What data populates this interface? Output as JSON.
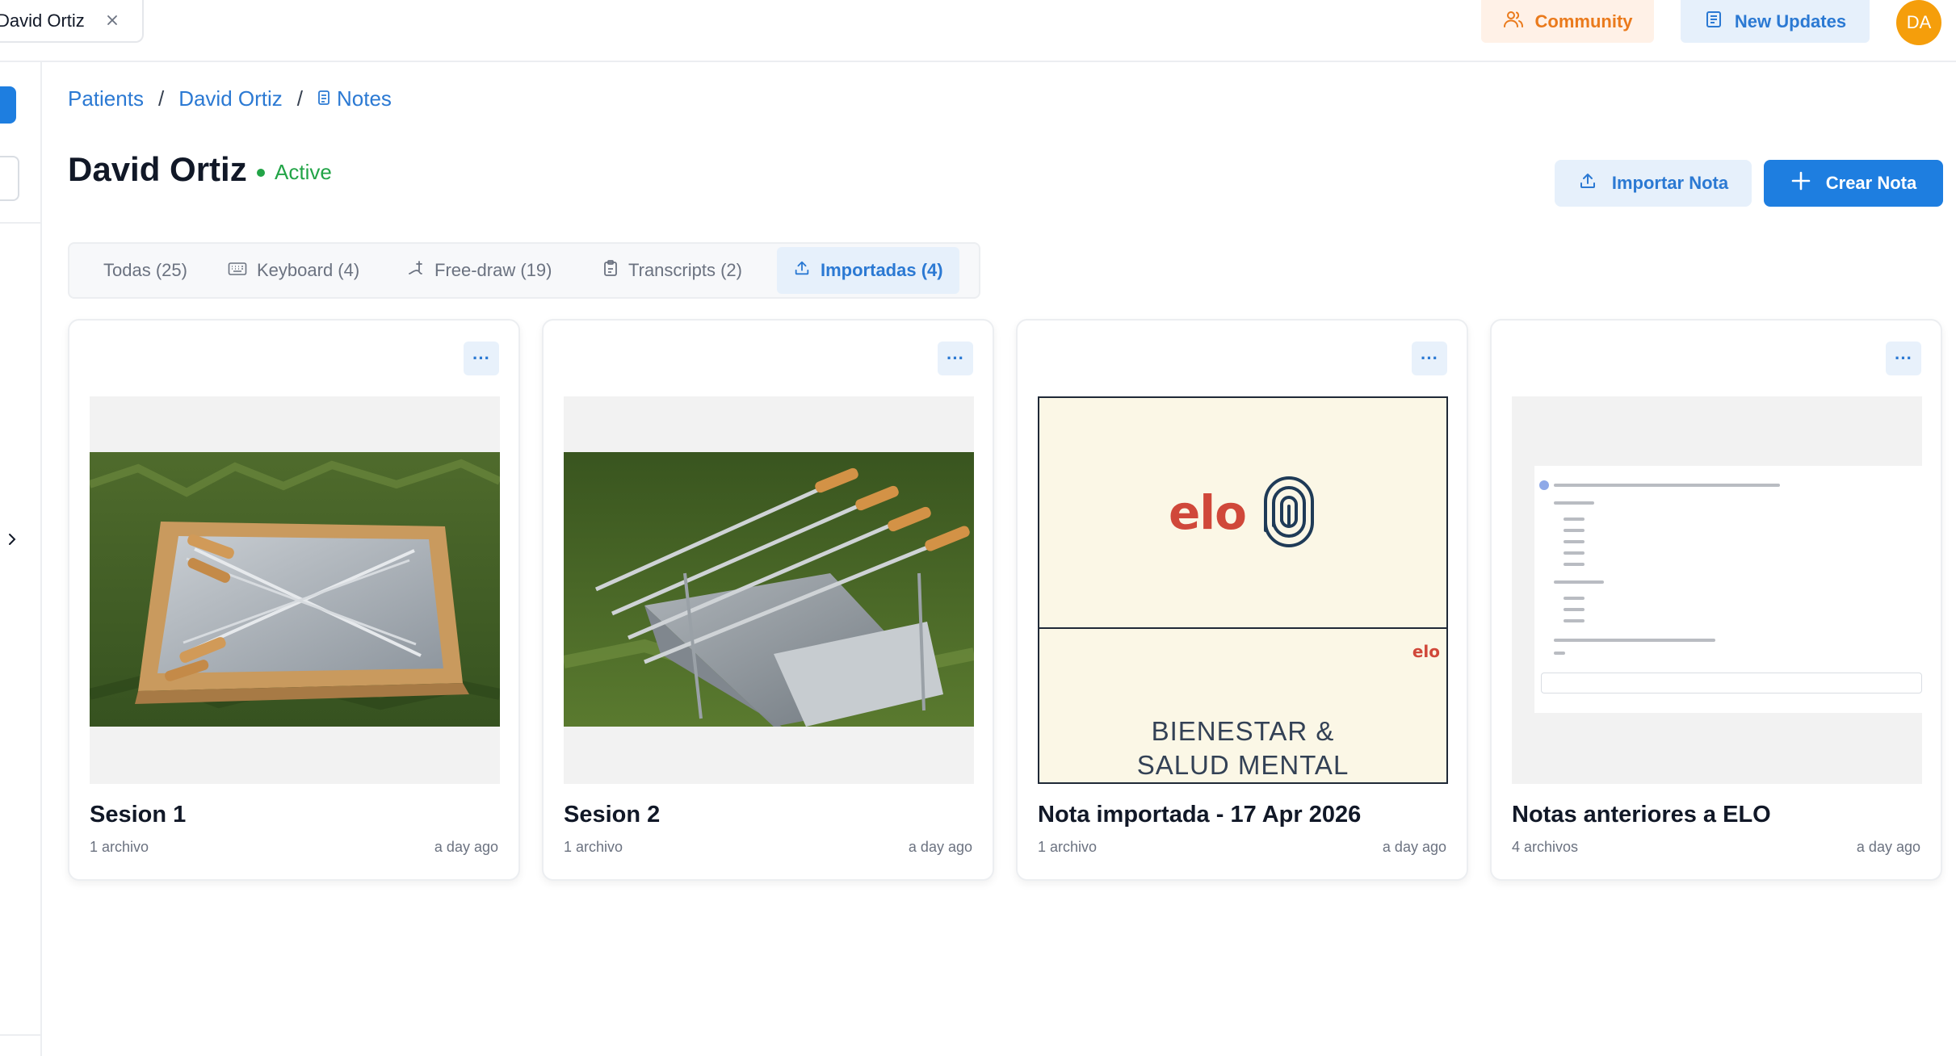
{
  "topbar": {
    "patient_tab": "David Ortiz",
    "community_label": "Community",
    "updates_label": "New Updates",
    "avatar_initials": "DA",
    "community_color": "#ea7a1c",
    "updates_color": "#2b79d3"
  },
  "breadcrumb": {
    "items": [
      "Patients",
      "David Ortiz",
      "Notes"
    ],
    "separator": "/"
  },
  "header": {
    "title": "David Ortiz",
    "status": "Active",
    "status_color": "#22a447",
    "import_label": "Importar Nota",
    "create_label": "Crear Nota",
    "accent": "#1e7ee0"
  },
  "filters": [
    {
      "label": "Todas (25)",
      "icon": "none",
      "active": false
    },
    {
      "label": "Keyboard (4)",
      "icon": "keyboard-icon",
      "active": false
    },
    {
      "label": "Free-draw (19)",
      "icon": "pen-icon",
      "active": false
    },
    {
      "label": "Transcripts (2)",
      "icon": "clipboard-icon",
      "active": false
    },
    {
      "label": "Importadas (4)",
      "icon": "upload-icon",
      "active": true
    }
  ],
  "notes": [
    {
      "title": "Sesion 1",
      "files": "1 archivo",
      "date": "a day ago",
      "preview": "photo-grill-box"
    },
    {
      "title": "Sesion 2",
      "files": "1 archivo",
      "date": "a day ago",
      "preview": "photo-grill-skewers"
    },
    {
      "title": "Nota importada - 17 Apr 2026",
      "files": "1 archivo",
      "date": "a day ago",
      "preview": "elo-poster"
    },
    {
      "title": "Notas anteriores a ELO",
      "files": "4 archivos",
      "date": "a day ago",
      "preview": "document-screenshot"
    }
  ],
  "poster": {
    "brand": "elo",
    "brand_small": "elo",
    "headline_1": "BIENESTAR &",
    "headline_2": "SALUD MENTAL",
    "brand_color": "#d0483a"
  },
  "card_menu_glyph": "···"
}
